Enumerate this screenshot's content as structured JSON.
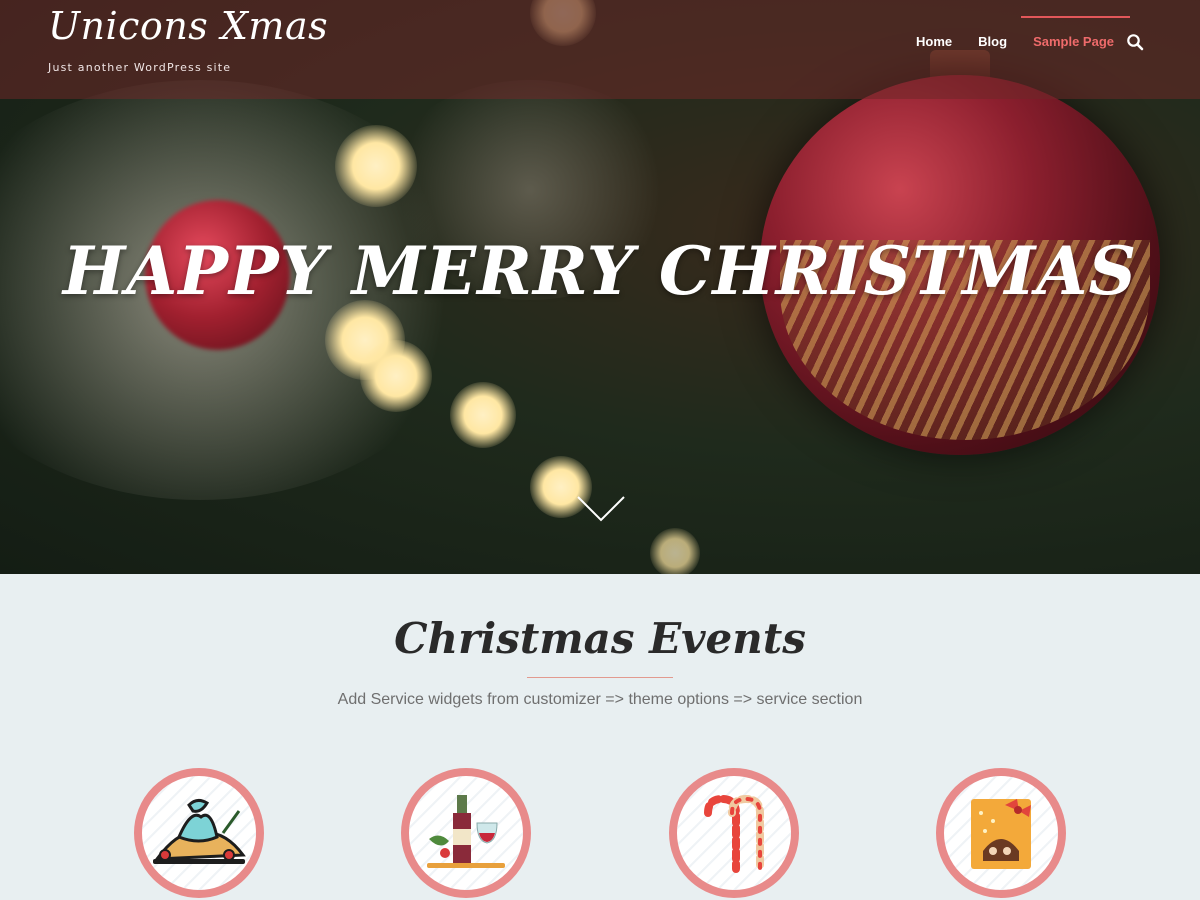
{
  "header": {
    "site_title": "Unicons Xmas",
    "tagline": "Just another WordPress site",
    "nav": [
      {
        "label": "Home",
        "active": false
      },
      {
        "label": "Blog",
        "active": false
      },
      {
        "label": "Sample Page",
        "active": true
      }
    ],
    "search_icon": "search-icon"
  },
  "hero": {
    "title": "HAPPY MERRY CHRISTMAS",
    "scroll_icon": "chevron-down-icon"
  },
  "events": {
    "title": "Christmas Events",
    "subtitle": "Add Service widgets from customizer => theme options => service section",
    "services": [
      {
        "icon": "roast-dinner-icon"
      },
      {
        "icon": "wine-bottle-icon"
      },
      {
        "icon": "candy-cane-icon"
      },
      {
        "icon": "gift-box-icon"
      }
    ]
  },
  "colors": {
    "accent": "#e2575a",
    "active_nav": "#ef6b6b",
    "circle_border": "#e88a8a",
    "section_bg": "#e8eff1"
  }
}
